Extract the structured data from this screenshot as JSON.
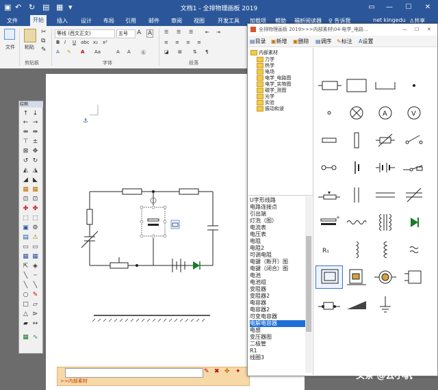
{
  "window": {
    "title": "文档1 - 全排物理画板 2019",
    "user": "net kingedu",
    "share": "共享",
    "tell_me": "告诉我"
  },
  "tabs": [
    "文件",
    "开始",
    "插入",
    "设计",
    "布局",
    "引用",
    "邮件",
    "审阅",
    "视图",
    "开发工具",
    "加载项",
    "帮助",
    "福昕阅读器"
  ],
  "ribbon": {
    "paste": "粘贴",
    "file": "文件",
    "font_name": "等线 (西文正文)",
    "font_size": "五号",
    "groups": [
      "剪贴板",
      "字体",
      "段落"
    ]
  },
  "draw_toolbar": {
    "title": "绘图"
  },
  "dialog": {
    "title": "全排物理画板 2019>>>内部素材\\04-电学_电路...",
    "toolbar": [
      "目录",
      "新增",
      "删除",
      "调序",
      "标注",
      "设置"
    ],
    "tree": [
      {
        "label": "内部素材",
        "level": 0
      },
      {
        "label": "力学",
        "level": 1
      },
      {
        "label": "热学",
        "level": 1
      },
      {
        "label": "电场",
        "level": 1
      },
      {
        "label": "电学_电路图",
        "level": 1
      },
      {
        "label": "电学_实物图",
        "level": 1
      },
      {
        "label": "磁学_测图",
        "level": 1
      },
      {
        "label": "光学",
        "level": 1
      },
      {
        "label": "实验",
        "level": 1
      },
      {
        "label": "振动和波",
        "level": 1
      }
    ],
    "list": [
      "U字形线路",
      "电路连接点",
      "引出端",
      "灯泡（图）",
      "电流表",
      "电压表",
      "电阻",
      "电阻2",
      "可调电阻",
      "电键（断开）图",
      "电键（闭合）图",
      "电池",
      "电池组",
      "变阻器",
      "变阻器2",
      "电容器",
      "电容器2",
      "可变电容器",
      "电解电容器",
      "电感",
      "变压器图",
      "二极管",
      "R1",
      "线圈3"
    ],
    "selected": "电解电容器",
    "symbols": [
      "rect-resistor-icon",
      "plain-rect-icon",
      "u-shape-wire-icon",
      "dot-icon",
      "terminal-icon",
      "lamp-icon",
      "ammeter-icon",
      "voltmeter-icon",
      "resistor-small-icon",
      "vertical-resistor-icon",
      "variable-resistor-icon",
      "switch-open-icon",
      "switch-terminals-icon",
      "cell-icon",
      "battery-icon",
      "switch-closed-icon",
      "rheostat-icon",
      "capacitor-vertical-icon",
      "capacitor-horizontal-icon",
      "variable-capacitor-icon",
      "electrolytic-capacitor-icon",
      "spring-icon",
      "transformer-icon",
      "diode-icon",
      "r1-label-icon",
      "inductor-icon",
      "coil-icon",
      "ac-source-icon",
      "coil-core-icon",
      "relay-icon",
      "motor-coil-icon",
      "solenoid-icon",
      "bell-icon",
      "wedge-icon",
      "ground-icon"
    ],
    "r1_label": "R1"
  },
  "bottom_bar": {
    "path": ">>内部素材"
  },
  "watermark": "头条 @云小帆"
}
